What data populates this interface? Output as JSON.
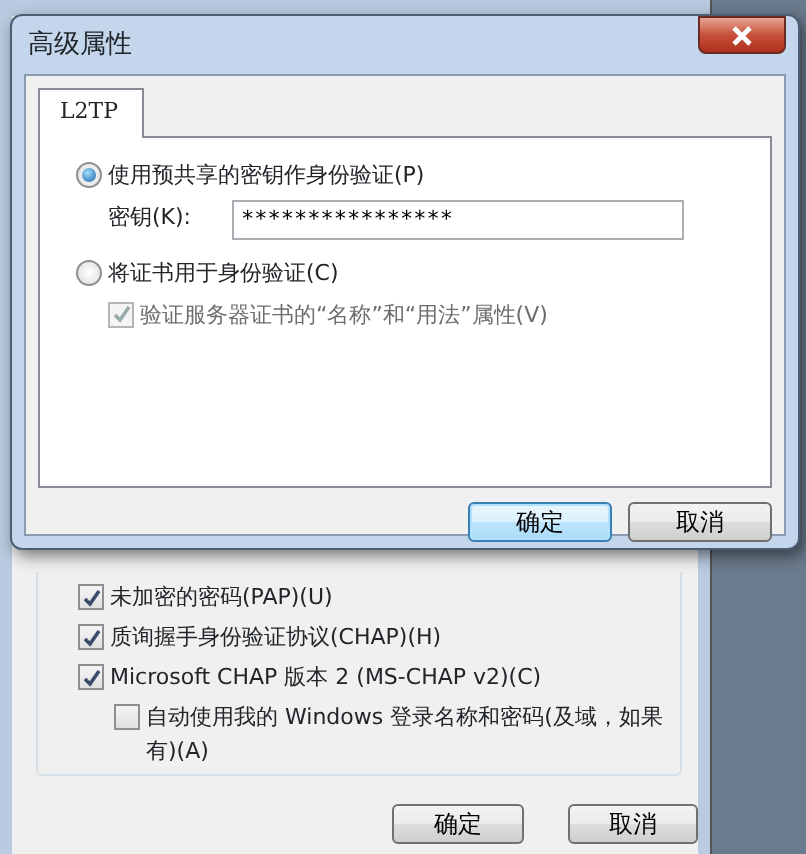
{
  "dialog": {
    "title": "高级属性",
    "tabs": [
      {
        "label": "L2TP",
        "selected": true
      }
    ],
    "options": [
      {
        "kind": "radio",
        "label": "使用预共享的密钥作身份验证(P)",
        "selected": true
      },
      {
        "kind": "password",
        "label": "密钥(K):",
        "value": "****************"
      },
      {
        "kind": "radio",
        "label": "将证书用于身份验证(C)",
        "selected": false
      },
      {
        "kind": "checkbox",
        "label": "验证服务器证书的“名称”和“用法”属性(V)",
        "checked": true,
        "disabled": true
      }
    ],
    "buttons": [
      {
        "label": "确定",
        "default": true
      },
      {
        "label": "取消",
        "default": false
      }
    ]
  },
  "background_window": {
    "auth_options": [
      {
        "label": "未加密的密码(PAP)(U)",
        "checked": true
      },
      {
        "label": "质询握手身份验证协议(CHAP)(H)",
        "checked": true
      },
      {
        "label": "Microsoft CHAP 版本 2 (MS-CHAP v2)(C)",
        "checked": true,
        "children": [
          {
            "label": "自动使用我的 Windows 登录名称和密码(及域，如果有)(A)",
            "checked": false
          }
        ]
      }
    ],
    "buttons": [
      {
        "label": "确定"
      },
      {
        "label": "取消"
      }
    ]
  }
}
